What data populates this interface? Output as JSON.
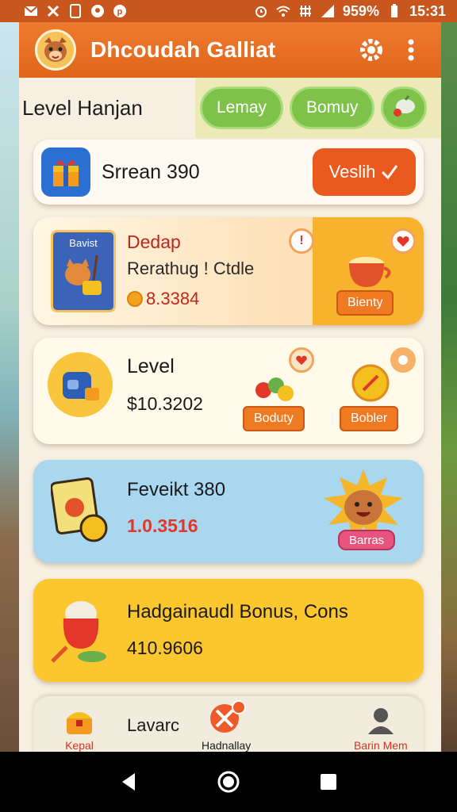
{
  "status_bar": {
    "battery": "959%",
    "time": "15:31",
    "left_icons": [
      "mail-icon",
      "tools-icon",
      "phone-icon",
      "location-icon",
      "pinterest-icon"
    ],
    "right_icons": [
      "alarm-icon",
      "wifi-icon",
      "network-icon",
      "signal-icon",
      "battery-icon"
    ]
  },
  "header": {
    "title": "Dhcoudah Galliat",
    "icons": [
      "settings-icon",
      "more-vert-icon"
    ]
  },
  "tabs": {
    "level_label": "Level  Hanjan",
    "pills": [
      "Lemay",
      "Bomuy"
    ]
  },
  "card1": {
    "label": "Srrean  390",
    "button": "Veslih"
  },
  "card2": {
    "book_label": "Bavist",
    "title": "Dedap",
    "subtitle": "Rerathug ! Ctdle",
    "value": "8.3384",
    "badge": "!",
    "tag": "Bienty"
  },
  "card3": {
    "title": "Level",
    "value": "$10.3202",
    "tag_left": "Boduty",
    "tag_right": "Bobler"
  },
  "card4": {
    "title": "Feveikt 380",
    "value": "1.0.3516",
    "tag": "Barras"
  },
  "card5": {
    "title": "Hadgainaudl Bonus, Cons",
    "value": "410.9606"
  },
  "bottom_nav": {
    "item_left": "Kepal",
    "center_text": "Lavarc",
    "item_center": "Hadnallay",
    "item_right": "Barin Mem"
  },
  "colors": {
    "brand_orange": "#e0661c",
    "accent_green": "#7ec24a",
    "card_blue": "#a9d7f0",
    "card_yellow": "#fcc72e"
  }
}
